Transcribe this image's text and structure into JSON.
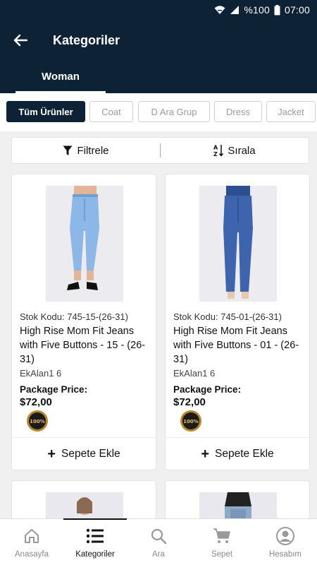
{
  "status_bar": {
    "battery_text": "%100",
    "time": "07:00"
  },
  "header": {
    "title": "Kategoriler",
    "tab_label": "Woman"
  },
  "chips": [
    "Tüm Ürünler",
    "Coat",
    "D Ara Grup",
    "Dress",
    "Jacket"
  ],
  "toolbar": {
    "filter_label": "Filtrele",
    "sort_label": "Sırala"
  },
  "products": [
    {
      "stok": "Stok Kodu: 745-15-(26-31)",
      "name": "High Rise Mom Fit Jeans with Five Buttons - 15 - (26-31)",
      "ekalan": "EkAlan1 6",
      "price_label": "Package Price:",
      "price": "$72,00",
      "badge_text": "100%",
      "add_to_cart": "Sepete Ekle"
    },
    {
      "stok": "Stok Kodu: 745-01-(26-31)",
      "name": "High Rise Mom Fit Jeans with Five Buttons - 01 - (26-31)",
      "ekalan": "EkAlan1 6",
      "price_label": "Package Price:",
      "price": "$72,00",
      "badge_text": "100%",
      "add_to_cart": "Sepete Ekle"
    }
  ],
  "bottom_nav": [
    {
      "label": "Anasayfa",
      "icon": "home-icon"
    },
    {
      "label": "Kategoriler",
      "icon": "list-icon",
      "active": true
    },
    {
      "label": "Ara",
      "icon": "search-icon"
    },
    {
      "label": "Sepet",
      "icon": "cart-icon"
    },
    {
      "label": "Hesabım",
      "icon": "account-icon"
    }
  ],
  "colors": {
    "header_bg": "#0e2236",
    "active_chip_bg": "#0e2236",
    "inactive_text": "#9a9a9a",
    "badge_gold": "#b8862b"
  }
}
